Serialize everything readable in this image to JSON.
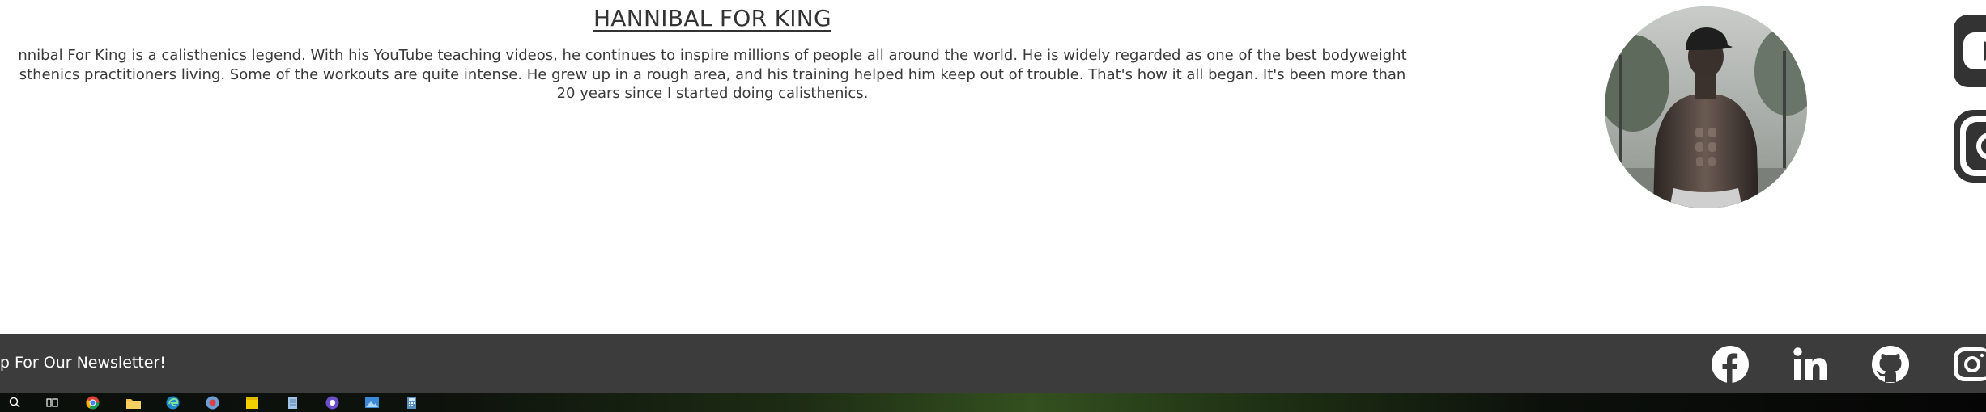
{
  "athlete": {
    "title": "HANNIBAL FOR KING",
    "description_lines": [
      "nnibal For King is a calisthenics legend. With his YouTube teaching videos, he continues to inspire millions of people all around the world. He is widely regarded as one of the best bodyweight",
      "sthenics practitioners living. Some of the workouts are quite intense. He grew up in a rough area, and his training helped him keep out of trouble. That's how it all began. It's been more than",
      "20 years since I started doing calisthenics."
    ],
    "photo_icon": "athlete-portrait"
  },
  "side_social": {
    "items": [
      {
        "name": "youtube",
        "icon": "youtube-icon"
      },
      {
        "name": "instagram",
        "icon": "instagram-icon"
      }
    ]
  },
  "footer": {
    "newsletter_text": "Up For Our Newsletter!",
    "social": [
      {
        "name": "facebook",
        "icon": "facebook-icon"
      },
      {
        "name": "linkedin",
        "icon": "linkedin-icon"
      },
      {
        "name": "github",
        "icon": "github-icon"
      },
      {
        "name": "instagram",
        "icon": "instagram-icon"
      }
    ]
  },
  "taskbar": {
    "items": [
      {
        "icon": "search-icon"
      },
      {
        "icon": "task-view-icon"
      },
      {
        "icon": "chrome-icon"
      },
      {
        "icon": "file-explorer-icon"
      },
      {
        "icon": "edge-icon"
      },
      {
        "icon": "browser-icon"
      },
      {
        "icon": "sticky-notes-icon"
      },
      {
        "icon": "document-icon"
      },
      {
        "icon": "app-icon"
      },
      {
        "icon": "photos-icon"
      },
      {
        "icon": "calculator-icon"
      }
    ]
  },
  "colors": {
    "footer_bg": "#3c3c3c",
    "text_dark": "#333333",
    "icon_white": "#ffffff",
    "icon_dark": "#333333"
  }
}
